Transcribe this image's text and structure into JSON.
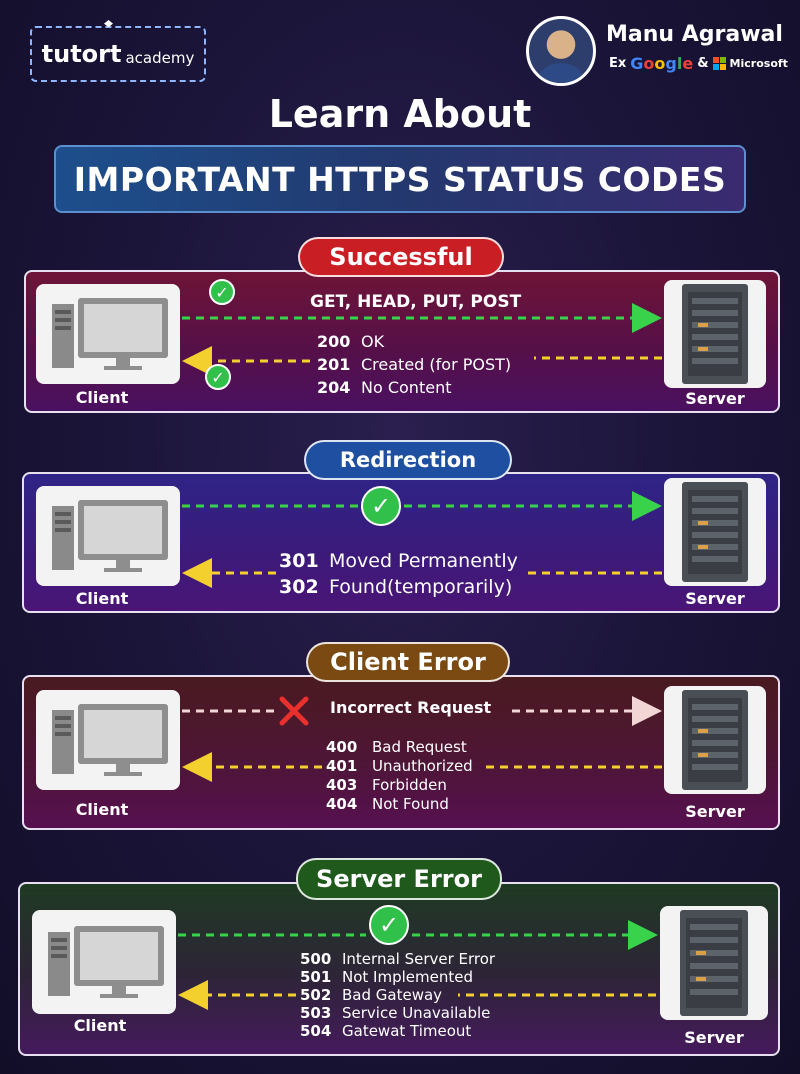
{
  "header": {
    "logo_main": "tutort",
    "logo_sub": "academy",
    "author_name": "Manu Agrawal",
    "author_prefix": "Ex",
    "google_word": "Google",
    "amp": "&",
    "microsoft_word": "Microsoft",
    "learn_title": "Learn About",
    "banner": "IMPORTANT HTTPS STATUS CODES"
  },
  "colors": {
    "successful": "#c81e24",
    "redirection": "#1f4fa0",
    "client_error": "#7a4a12",
    "server_error": "#1f5a1c",
    "green_arrow": "#39d34b",
    "yellow_arrow": "#f3d02e",
    "pink_arrow": "#f2d5d5",
    "cross": "#e8302d"
  },
  "labels": {
    "client": "Client",
    "server": "Server"
  },
  "sections": {
    "successful": {
      "title": "Successful",
      "request": "GET, HEAD, PUT, POST",
      "codes": [
        {
          "code": "200",
          "text": "OK"
        },
        {
          "code": "201",
          "text": "Created (for POST)"
        },
        {
          "code": "204",
          "text": "No Content"
        }
      ]
    },
    "redirection": {
      "title": "Redirection",
      "codes": [
        {
          "code": "301",
          "text": "Moved Permanently"
        },
        {
          "code": "302",
          "text": "Found(temporarily)"
        }
      ]
    },
    "client_error": {
      "title": "Client Error",
      "request": "Incorrect Request",
      "codes": [
        {
          "code": "400",
          "text": "Bad Request"
        },
        {
          "code": "401",
          "text": "Unauthorized"
        },
        {
          "code": "403",
          "text": "Forbidden"
        },
        {
          "code": "404",
          "text": "Not Found"
        }
      ]
    },
    "server_error": {
      "title": "Server Error",
      "codes": [
        {
          "code": "500",
          "text": "Internal Server Error"
        },
        {
          "code": "501",
          "text": "Not Implemented"
        },
        {
          "code": "502",
          "text": "Bad Gateway"
        },
        {
          "code": "503",
          "text": "Service Unavailable"
        },
        {
          "code": "504",
          "text": "Gatewat Timeout"
        }
      ]
    }
  },
  "icons": {
    "check": "✓",
    "cross": "✕",
    "client": "desktop-computer-icon",
    "server": "server-rack-icon"
  }
}
